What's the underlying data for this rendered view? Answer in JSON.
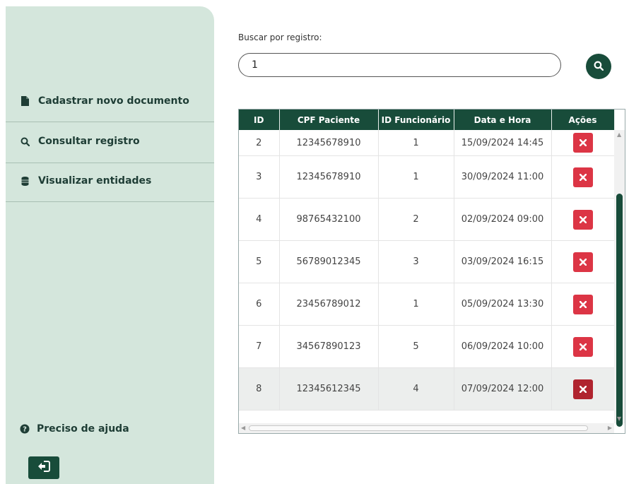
{
  "sidebar": {
    "items": [
      {
        "label": "Cadastrar novo documento",
        "icon": "file-icon"
      },
      {
        "label": "Consultar registro",
        "icon": "search-icon"
      },
      {
        "label": "Visualizar entidades",
        "icon": "database-icon"
      }
    ],
    "help_label": "Preciso de ajuda",
    "logout_icon": "sign-out-icon"
  },
  "search": {
    "label": "Buscar por registro:",
    "value": "1",
    "button_icon": "search-icon"
  },
  "table": {
    "columns": [
      "ID",
      "CPF Paciente",
      "ID Funcionário",
      "Data e Hora",
      "Ações"
    ],
    "rows": [
      {
        "id": "2",
        "cpf": "12345678910",
        "func": "1",
        "datetime": "15/09/2024 14:45"
      },
      {
        "id": "3",
        "cpf": "12345678910",
        "func": "1",
        "datetime": "30/09/2024 11:00"
      },
      {
        "id": "4",
        "cpf": "98765432100",
        "func": "2",
        "datetime": "02/09/2024 09:00"
      },
      {
        "id": "5",
        "cpf": "56789012345",
        "func": "3",
        "datetime": "03/09/2024 16:15"
      },
      {
        "id": "6",
        "cpf": "23456789012",
        "func": "1",
        "datetime": "05/09/2024 13:30"
      },
      {
        "id": "7",
        "cpf": "34567890123",
        "func": "5",
        "datetime": "06/09/2024 10:00"
      },
      {
        "id": "8",
        "cpf": "12345612345",
        "func": "4",
        "datetime": "07/09/2024 12:00"
      }
    ]
  },
  "colors": {
    "primary": "#184c3a",
    "sidebar_bg": "#d4e6dc",
    "delete": "#dc3545"
  }
}
